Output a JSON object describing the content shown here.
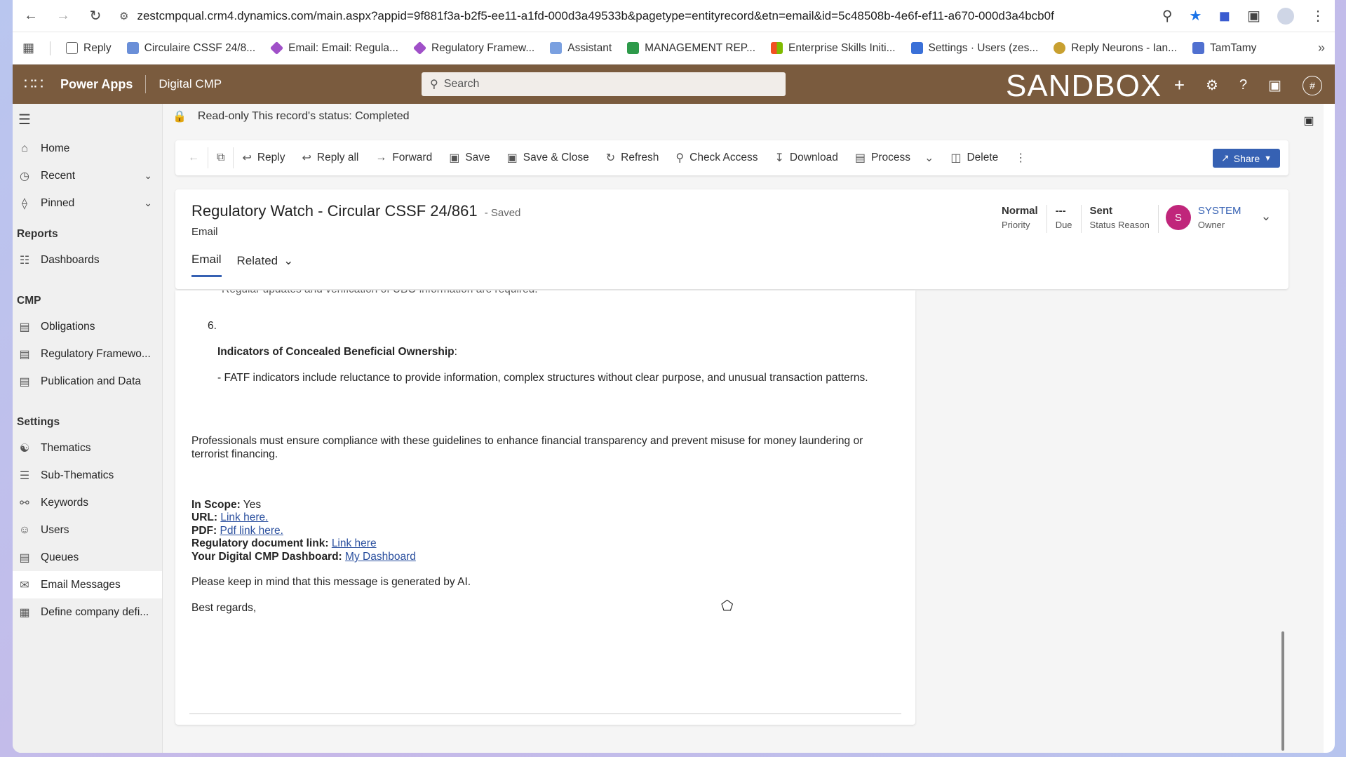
{
  "browser": {
    "url": "zestcmpqual.crm4.dynamics.com/main.aspx?appid=9f881f3a-b2f5-ee11-a1fd-000d3a49533b&pagetype=entityrecord&etn=email&id=5c48508b-4e6f-ef11-a670-000d3a4bcb0f",
    "bookmarks": [
      {
        "label": "Reply",
        "color": "#6b6b6b"
      },
      {
        "label": "Circulaire CSSF 24/8...",
        "color": "#6a8fd8"
      },
      {
        "label": "Email: Email: Regula...",
        "color": "#a050c8"
      },
      {
        "label": "Regulatory Framew...",
        "color": "#a050c8"
      },
      {
        "label": "Assistant",
        "color": "#7aa0e0"
      },
      {
        "label": "MANAGEMENT REP...",
        "color": "#2e9a4a"
      },
      {
        "label": "Enterprise Skills Initi...",
        "color": "#e8541e"
      },
      {
        "label": "Settings · Users (zes...",
        "color": "#3a70d8"
      },
      {
        "label": "Reply Neurons - Ian...",
        "color": "#c8a030"
      },
      {
        "label": "TamTamy",
        "color": "#5070d0"
      }
    ]
  },
  "app": {
    "name": "Power Apps",
    "environment": "Digital CMP",
    "search_placeholder": "Search",
    "banner": "SANDBOX",
    "header_bg": "#7a5b3e"
  },
  "nav": {
    "home": "Home",
    "recent": "Recent",
    "pinned": "Pinned",
    "group_reports": "Reports",
    "dashboards": "Dashboards",
    "group_cmp": "CMP",
    "obligations": "Obligations",
    "regulatory": "Regulatory Framewo...",
    "publication": "Publication and Data",
    "group_settings": "Settings",
    "thematics": "Thematics",
    "subthematics": "Sub-Thematics",
    "keywords": "Keywords",
    "users": "Users",
    "queues": "Queues",
    "email_messages": "Email Messages",
    "define_company": "Define company defi..."
  },
  "readonly_notice": "Read-only This record's status: Completed",
  "commands": {
    "reply": "Reply",
    "reply_all": "Reply all",
    "forward": "Forward",
    "save": "Save",
    "save_close": "Save & Close",
    "refresh": "Refresh",
    "check_access": "Check Access",
    "download": "Download",
    "process": "Process",
    "delete": "Delete",
    "share": "Share"
  },
  "record": {
    "title": "Regulatory Watch - Circular CSSF 24/861",
    "saved": "- Saved",
    "entity": "Email",
    "tabs": {
      "email": "Email",
      "related": "Related"
    },
    "priority_value": "Normal",
    "priority_label": "Priority",
    "due_value": "---",
    "due_label": "Due",
    "status_value": "Sent",
    "status_label": "Status Reason",
    "owner_initial": "S",
    "owner_value": "SYSTEM",
    "owner_label": "Owner"
  },
  "body": {
    "cut_line": "Regular updates and verification of UBO information are required.",
    "item_number": "6.",
    "item_heading": "Indicators of Concealed Beneficial Ownership",
    "item_colon": ":",
    "item_text": "- FATF indicators include reluctance to provide information, complex structures without clear purpose, and unusual transaction patterns.",
    "para_line1": "Professionals must ensure compliance with these guidelines to enhance financial transparency and prevent misuse for money laundering or",
    "para_line2": "terrorist financing.",
    "inscope_label": "In Scope:",
    "inscope_value": " Yes",
    "url_label": "URL:",
    "url_link": "Link here.",
    "pdf_label": "PDF:",
    "pdf_link": "Pdf link here.",
    "regdoc_label": "Regulatory document link:",
    "regdoc_link": "Link here",
    "dashboard_label": "Your Digital CMP Dashboard:",
    "dashboard_link": "My Dashboard",
    "ai_note": "Please keep in mind that this message is generated by AI.",
    "closing": "Best regards,"
  }
}
